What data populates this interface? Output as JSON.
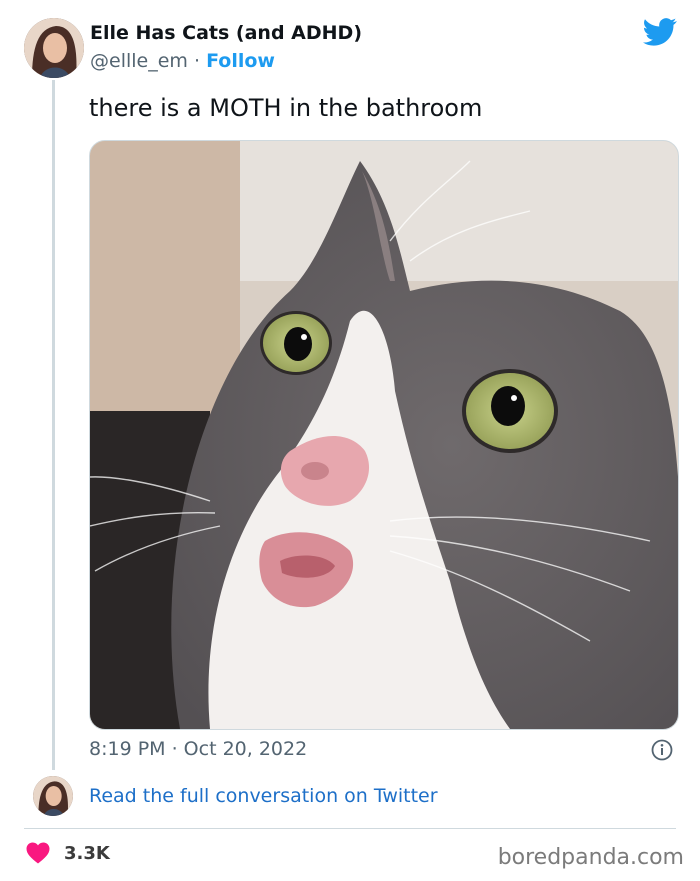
{
  "author": {
    "display_name": "Elle Has Cats (and ADHD)",
    "handle": "@ellle_em",
    "separator": "·",
    "follow_label": "Follow"
  },
  "tweet": {
    "text": "there is a MOTH in the bathroom",
    "timestamp": "8:19 PM · Oct 20, 2022"
  },
  "footer": {
    "read_more": "Read the full conversation on Twitter",
    "likes": "3.3K",
    "watermark": "boredpanda.com"
  },
  "icons": {
    "twitter": "twitter-bird-icon",
    "info": "info-icon",
    "heart": "heart-icon"
  },
  "colors": {
    "accent": "#1d9bf0",
    "link": "#1d6fc8",
    "heart": "#f91880",
    "muted": "#536471"
  }
}
